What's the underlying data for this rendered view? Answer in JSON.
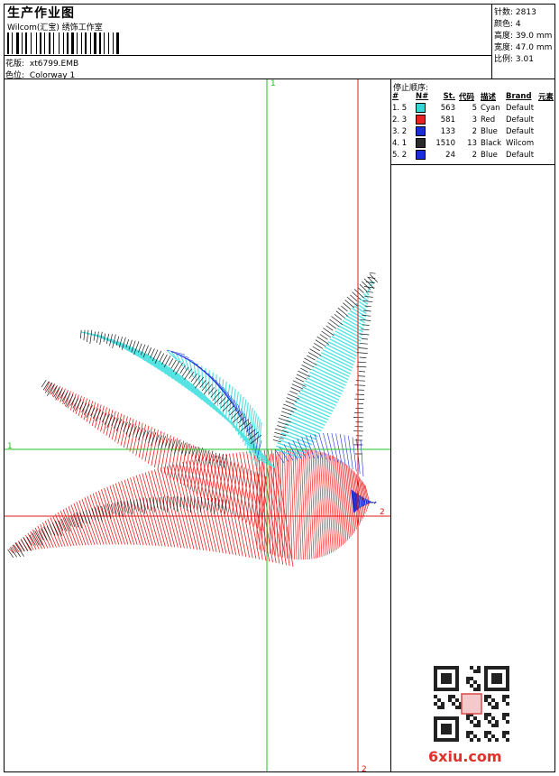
{
  "header": {
    "title": "生产作业图",
    "company": "Wilcom(汇宝) 绣饰工作室",
    "design_label": "花版:",
    "design_file": "xt6799.EMB",
    "colorway_label": "色位:",
    "colorway": "Colorway 1"
  },
  "stats": {
    "stitches_label": "针数:",
    "stitches": "2813",
    "colors_label": "颜色:",
    "colors": "4",
    "height_label": "高度:",
    "height": "39.0 mm",
    "width_label": "宽度:",
    "width": "47.0 mm",
    "scale_label": "比例:",
    "scale": "3.01"
  },
  "stop_sequence": {
    "title": "停止顺序:",
    "headers": [
      "#",
      "N#",
      "St.",
      "代码",
      "描述",
      "Brand",
      "元素"
    ],
    "rows": [
      {
        "order": "1. 5",
        "code": "563",
        "num": "5",
        "desc": "Cyan",
        "brand": "Default",
        "color": "#33d6d6"
      },
      {
        "order": "2. 3",
        "code": "581",
        "num": "3",
        "desc": "Red",
        "brand": "Default",
        "color": "#e52222"
      },
      {
        "order": "3. 2",
        "code": "133",
        "num": "2",
        "desc": "Blue",
        "brand": "Default",
        "color": "#1a2ed8"
      },
      {
        "order": "4. 1",
        "code": "1510",
        "num": "13",
        "desc": "Black",
        "brand": "Wilcom",
        "color": "#2a2a2a"
      },
      {
        "order": "5. 2",
        "code": "24",
        "num": "2",
        "desc": "Blue",
        "brand": "Default",
        "color": "#1a2ed8"
      }
    ]
  },
  "guides": {
    "green_label_top": "1",
    "green_label_left": "1",
    "red_label_right": "2",
    "red_label_bottom": "2",
    "green_color": "#22c022",
    "red_color": "#e01818"
  },
  "thread_colors": {
    "cyan": "#55e3e3",
    "red": "#e52222",
    "blue": "#1a2ed8",
    "black": "#1a1a1a"
  },
  "watermark": {
    "site": "6xiu.com",
    "color": "#e0312b"
  }
}
